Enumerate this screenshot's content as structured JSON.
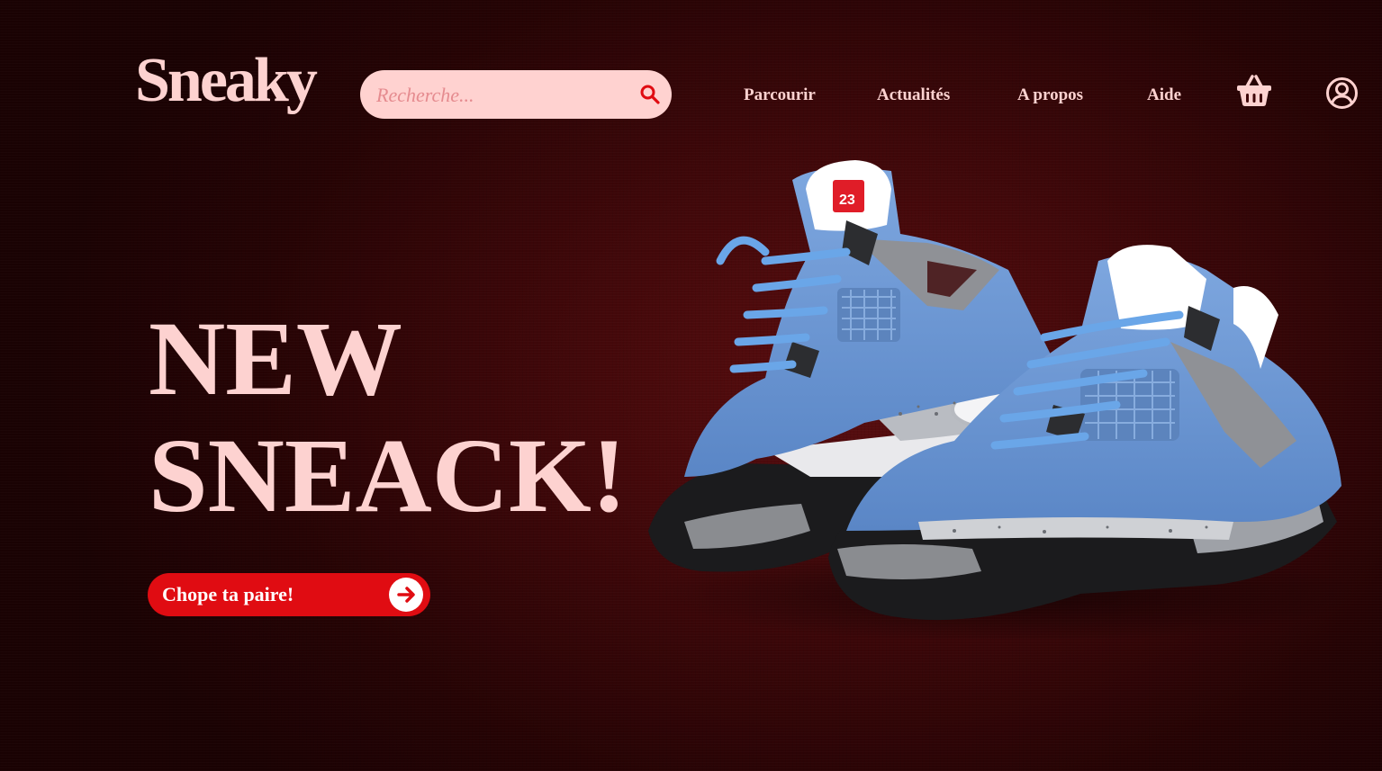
{
  "brand": {
    "name": "Sneaky"
  },
  "search": {
    "placeholder": "Recherche..."
  },
  "nav": {
    "items": [
      {
        "label": "Parcourir"
      },
      {
        "label": "Actualités"
      },
      {
        "label": "A propos"
      },
      {
        "label": "Aide"
      }
    ],
    "cart_icon": "basket-icon",
    "account_icon": "user-circle-icon"
  },
  "hero": {
    "headline_line1": "NEW",
    "headline_line2": "SNEACK!",
    "cta_label": "Chope ta paire!",
    "cta_icon": "arrow-right-circle-icon",
    "image_icon": "sneakers-image"
  },
  "colors": {
    "background": "#3e0709",
    "brand_pink": "#fdd2d0",
    "accent_red": "#e00c12",
    "shoe_blue": "#6f9bd6"
  }
}
